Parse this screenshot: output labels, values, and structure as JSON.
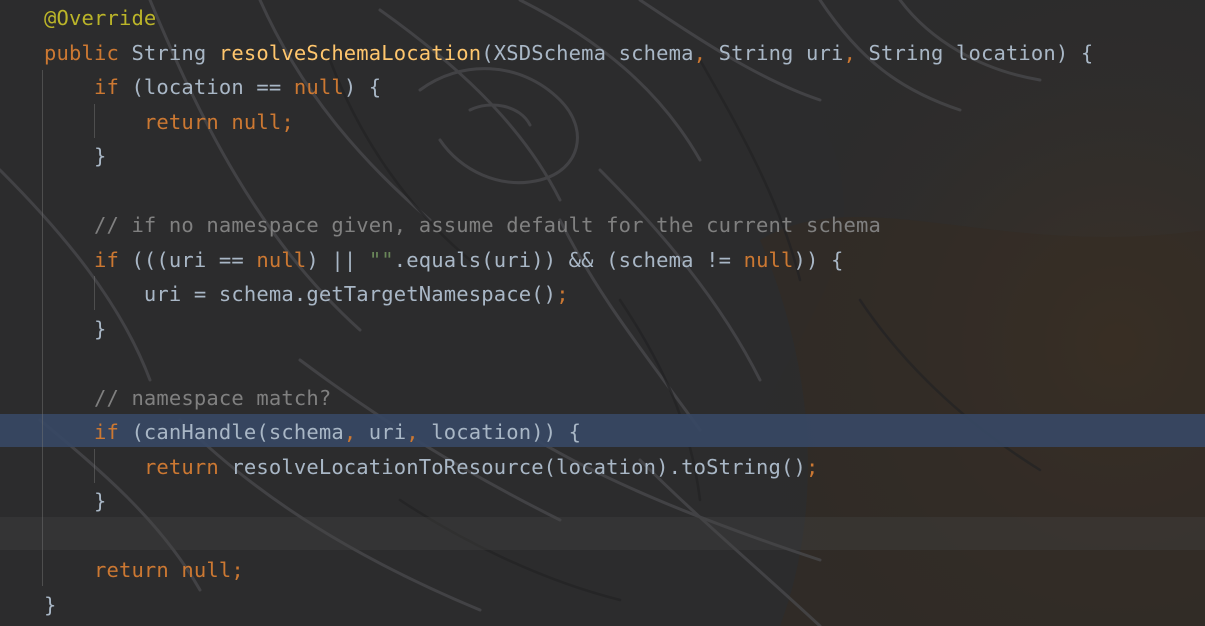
{
  "editor": {
    "colors": {
      "background": "#2b2b2b",
      "keyword": "#cc7832",
      "method_declaration": "#ffc66d",
      "annotation": "#bbb529",
      "comment": "#808080",
      "string": "#6a8759",
      "plain": "#a9b7c6",
      "caret_line": "#344860"
    },
    "caret_line_index": 12,
    "lines": [
      {
        "tokens": [
          {
            "t": "@Override",
            "k": "annotation"
          }
        ]
      },
      {
        "tokens": [
          {
            "t": "public",
            "k": "keyword"
          },
          {
            "t": " String ",
            "k": "plain"
          },
          {
            "t": "resolveSchemaLocation",
            "k": "method"
          },
          {
            "t": "(XSDSchema schema",
            "k": "plain"
          },
          {
            "t": ",",
            "k": "punct"
          },
          {
            "t": " String uri",
            "k": "plain"
          },
          {
            "t": ",",
            "k": "punct"
          },
          {
            "t": " String location) {",
            "k": "plain"
          }
        ]
      },
      {
        "tokens": [
          {
            "t": "    ",
            "k": "plain"
          },
          {
            "t": "if",
            "k": "keyword"
          },
          {
            "t": " (location == ",
            "k": "plain"
          },
          {
            "t": "null",
            "k": "keyword"
          },
          {
            "t": ") {",
            "k": "plain"
          }
        ]
      },
      {
        "tokens": [
          {
            "t": "        ",
            "k": "plain"
          },
          {
            "t": "return null",
            "k": "keyword"
          },
          {
            "t": ";",
            "k": "punct"
          }
        ]
      },
      {
        "tokens": [
          {
            "t": "    }",
            "k": "plain"
          }
        ]
      },
      {
        "tokens": []
      },
      {
        "tokens": [
          {
            "t": "    ",
            "k": "plain"
          },
          {
            "t": "// if no namespace given, assume default for the current schema",
            "k": "comment"
          }
        ]
      },
      {
        "tokens": [
          {
            "t": "    ",
            "k": "plain"
          },
          {
            "t": "if",
            "k": "keyword"
          },
          {
            "t": " (((uri == ",
            "k": "plain"
          },
          {
            "t": "null",
            "k": "keyword"
          },
          {
            "t": ") || ",
            "k": "plain"
          },
          {
            "t": "\"\"",
            "k": "string"
          },
          {
            "t": ".equals(uri)) && (schema != ",
            "k": "plain"
          },
          {
            "t": "null",
            "k": "keyword"
          },
          {
            "t": ")) {",
            "k": "plain"
          }
        ]
      },
      {
        "tokens": [
          {
            "t": "        uri = schema.getTargetNamespace()",
            "k": "plain"
          },
          {
            "t": ";",
            "k": "punct"
          }
        ]
      },
      {
        "tokens": [
          {
            "t": "    }",
            "k": "plain"
          }
        ]
      },
      {
        "tokens": []
      },
      {
        "tokens": [
          {
            "t": "    ",
            "k": "plain"
          },
          {
            "t": "// namespace match?",
            "k": "comment"
          }
        ]
      },
      {
        "tokens": [
          {
            "t": "    ",
            "k": "plain"
          },
          {
            "t": "if",
            "k": "keyword"
          },
          {
            "t": " (canHandle(schema",
            "k": "plain"
          },
          {
            "t": ",",
            "k": "punct"
          },
          {
            "t": " uri",
            "k": "plain"
          },
          {
            "t": ",",
            "k": "punct"
          },
          {
            "t": " location)) {",
            "k": "plain"
          }
        ]
      },
      {
        "tokens": [
          {
            "t": "        ",
            "k": "plain"
          },
          {
            "t": "return",
            "k": "keyword"
          },
          {
            "t": " resolveLocationToResource(location).toString()",
            "k": "plain"
          },
          {
            "t": ";",
            "k": "punct"
          }
        ]
      },
      {
        "tokens": [
          {
            "t": "    }",
            "k": "plain"
          }
        ]
      },
      {
        "tokens": []
      },
      {
        "tokens": [
          {
            "t": "    ",
            "k": "plain"
          },
          {
            "t": "return null",
            "k": "keyword"
          },
          {
            "t": ";",
            "k": "punct"
          }
        ]
      },
      {
        "tokens": [
          {
            "t": "}",
            "k": "plain"
          }
        ]
      }
    ]
  }
}
